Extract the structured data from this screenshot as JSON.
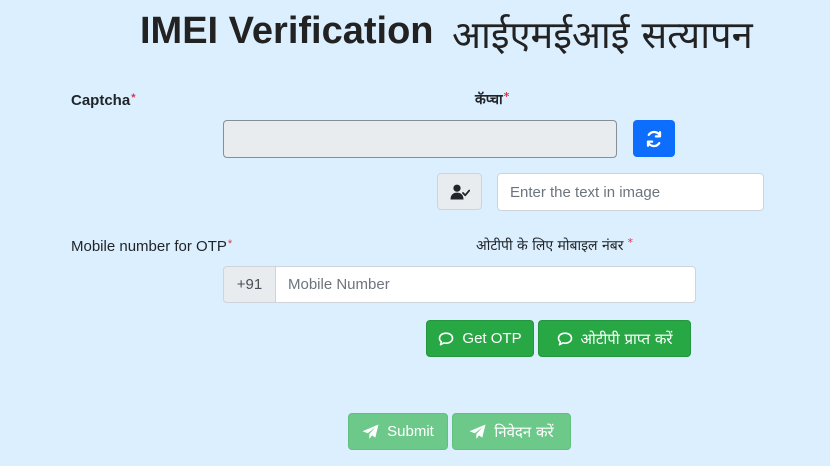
{
  "page": {
    "title_en": "IMEI Verification",
    "title_hi": "आईएमईआई सत्यापन"
  },
  "captcha": {
    "label_en": "Captcha",
    "label_hi": "कॅप्चा",
    "required_mark": "*",
    "input_placeholder": "Enter the text in image",
    "refresh_icon": "refresh-icon",
    "user_check_icon": "user-check-icon"
  },
  "mobile": {
    "label_en": "Mobile number for OTP",
    "label_hi": "ओटीपी के लिए मोबाइल नंबर",
    "required_mark": "*",
    "prefix": "+91",
    "placeholder": "Mobile Number"
  },
  "buttons": {
    "get_otp_en": "Get OTP",
    "get_otp_hi": "ओटीपी प्राप्त करें",
    "submit_en": "Submit",
    "submit_hi": "निवेदन करें",
    "chat_icon": "chat-bubble-icon",
    "send_icon": "paper-plane-icon"
  },
  "colors": {
    "background": "#dcefff",
    "primary": "#0d6efd",
    "success": "#28a745",
    "required": "#dc3545"
  }
}
